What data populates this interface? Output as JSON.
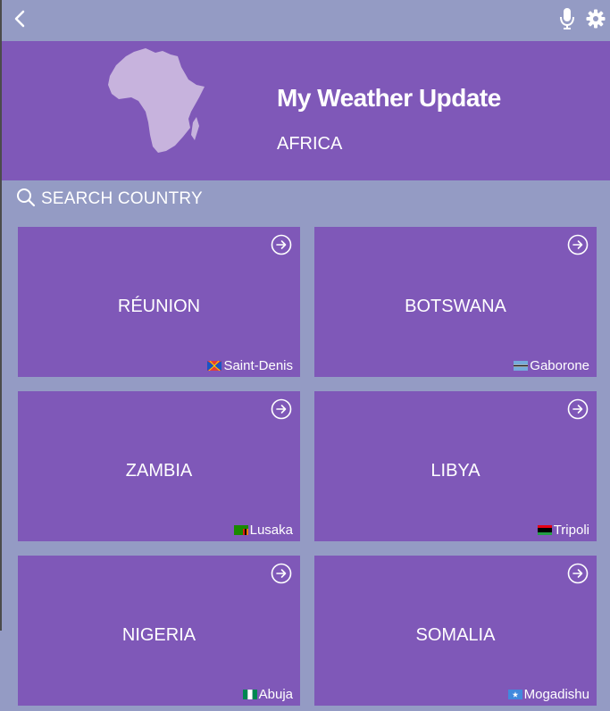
{
  "app": {
    "title": "My Weather Update",
    "region": "AFRICA"
  },
  "icons": {
    "back": "back-chevron-icon",
    "mic": "microphone-icon",
    "settings": "gear-icon",
    "map": "africa-map-icon",
    "search": "search-icon",
    "card_arrow": "arrow-circle-right-icon"
  },
  "search": {
    "label": "SEARCH COUNTRY"
  },
  "colors": {
    "background": "#949bc4",
    "panel": "#7f58b8",
    "map_fill": "#c7b3dd",
    "text": "#ffffff"
  },
  "countries": [
    {
      "name": "RÉUNION",
      "capital": "Saint-Denis",
      "flag": "reunion-flag-icon"
    },
    {
      "name": "BOTSWANA",
      "capital": "Gaborone",
      "flag": "botswana-flag-icon"
    },
    {
      "name": "ZAMBIA",
      "capital": "Lusaka",
      "flag": "zambia-flag-icon"
    },
    {
      "name": "LIBYA",
      "capital": "Tripoli",
      "flag": "libya-flag-icon"
    },
    {
      "name": "NIGERIA",
      "capital": "Abuja",
      "flag": "nigeria-flag-icon"
    },
    {
      "name": "SOMALIA",
      "capital": "Mogadishu",
      "flag": "somalia-flag-icon"
    }
  ]
}
